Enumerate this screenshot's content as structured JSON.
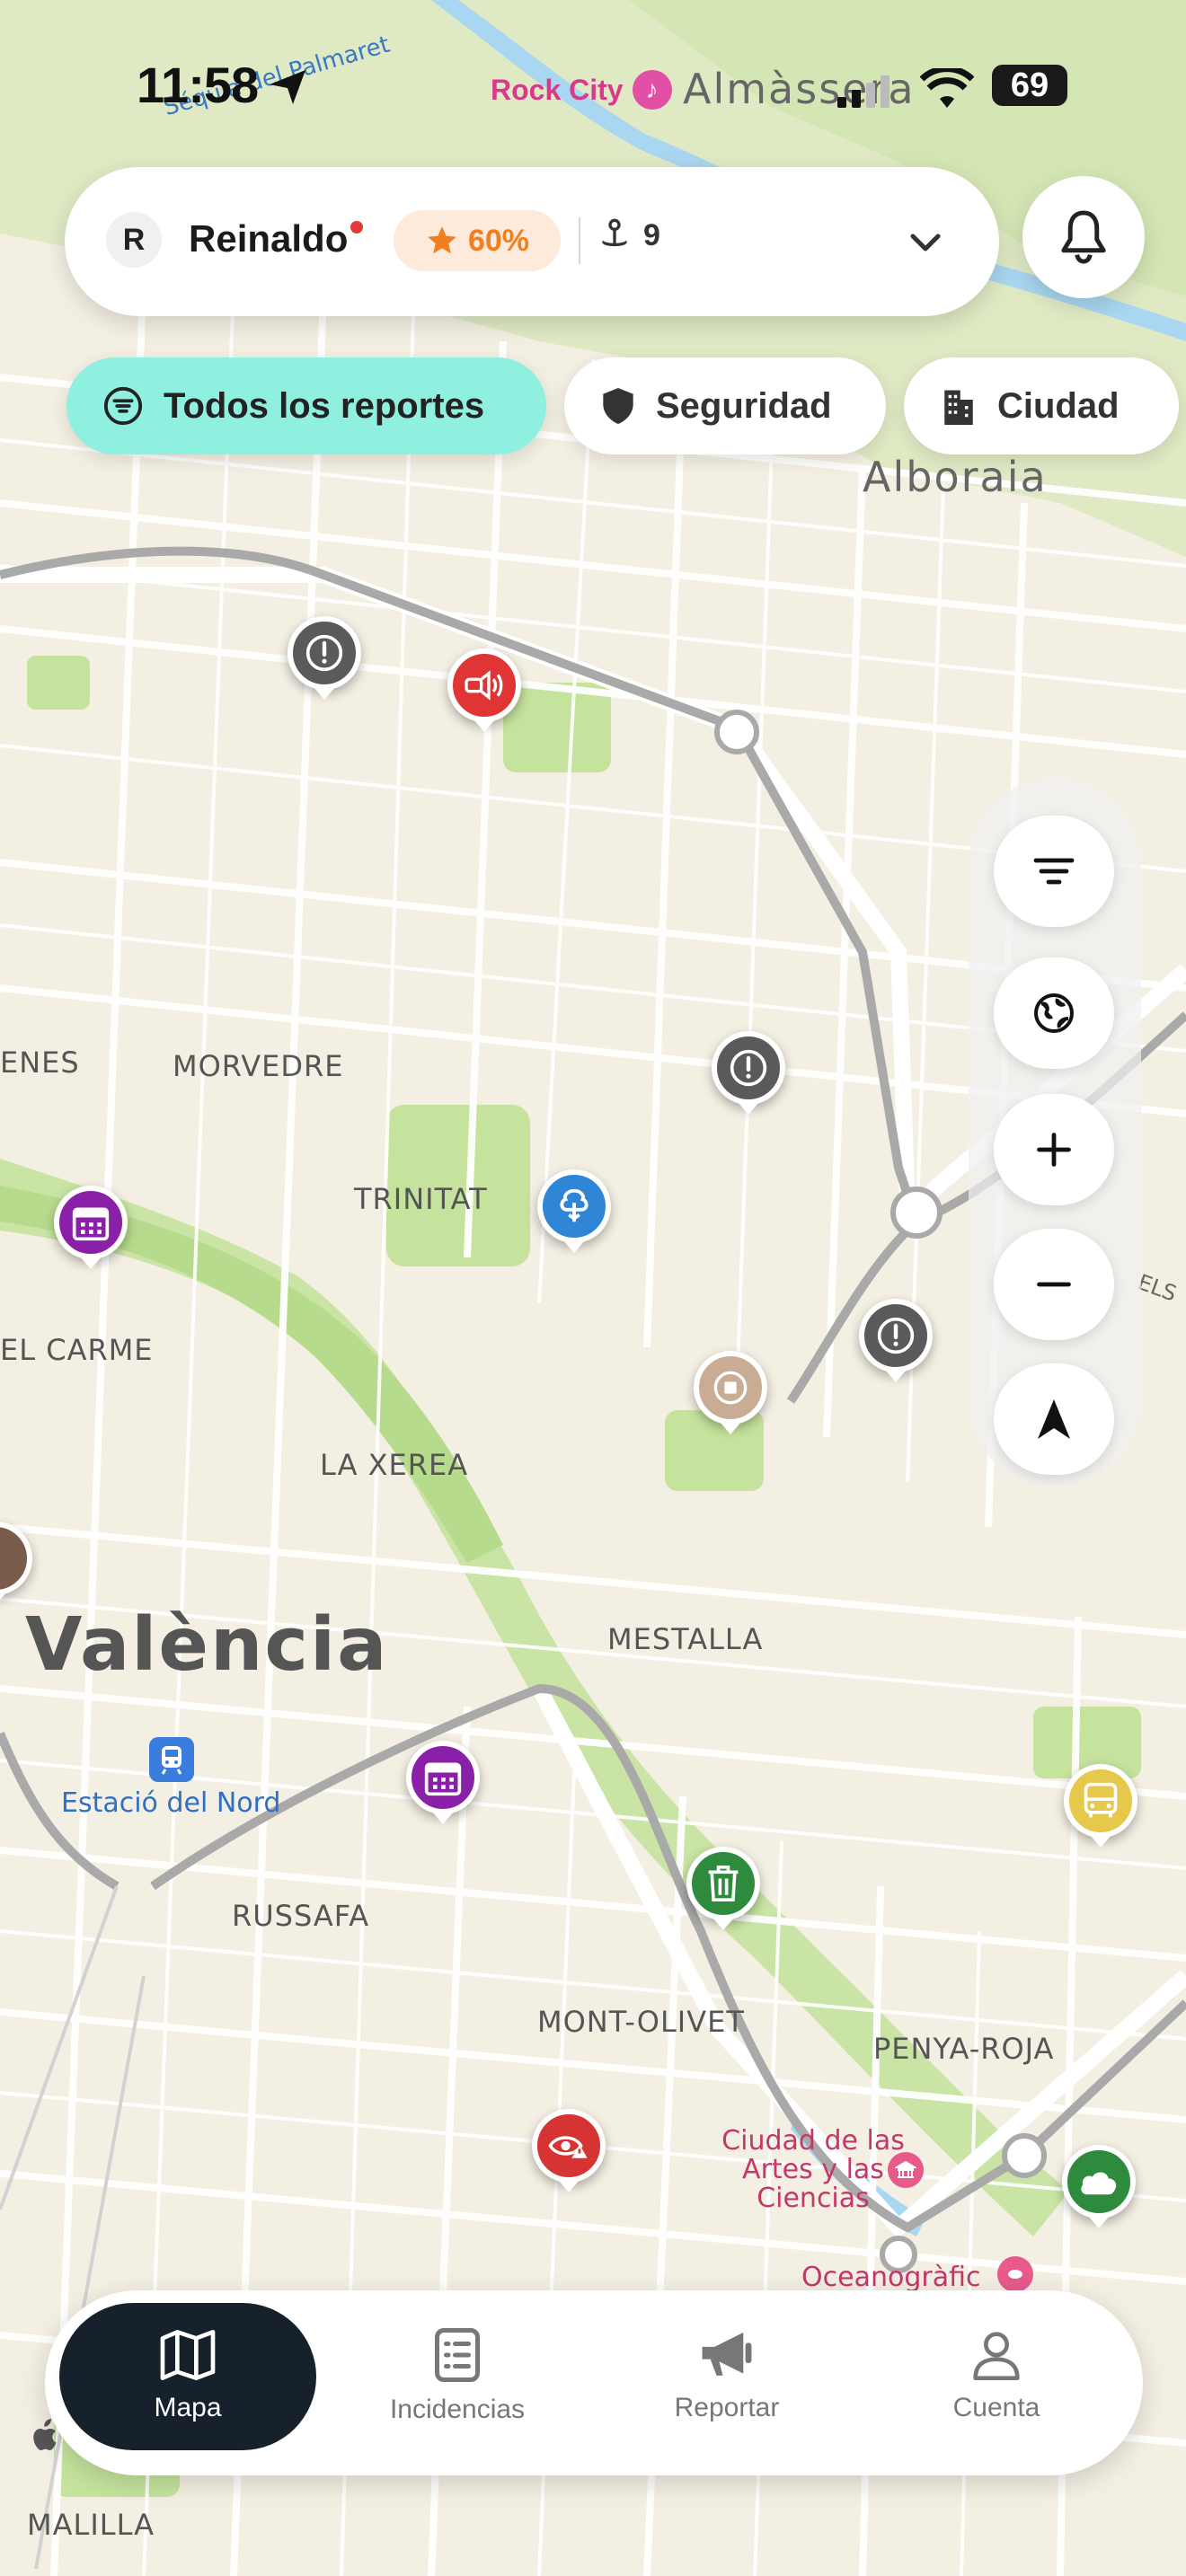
{
  "status_bar": {
    "time": "11:58",
    "battery": "69",
    "now_playing": "Rock City"
  },
  "header": {
    "avatar_initial": "R",
    "username": "Reinaldo",
    "score": "60%",
    "pins_count": "9"
  },
  "filters": [
    {
      "label": "Todos los reportes",
      "icon": "list-filter-icon",
      "active": true
    },
    {
      "label": "Seguridad",
      "icon": "shield-icon",
      "active": false
    },
    {
      "label": "Ciudad",
      "icon": "building-icon",
      "active": false
    }
  ],
  "map_controls": [
    "filter-lines-icon",
    "globe-icon",
    "zoom-in-icon",
    "zoom-out-icon",
    "compass-icon"
  ],
  "map_labels": {
    "street_palmaret": "Séquia del Palmaret",
    "almassera": "Almàssera",
    "alboraia": "Alboraia",
    "morvedre": "MORVEDRE",
    "enes": "ENES",
    "trinitat": "TRINITAT",
    "el_carme": "EL CARME",
    "la_xerea": "LA XEREA",
    "valencia": "València",
    "mestalla": "MESTALLA",
    "estacio": "Estació del Nord",
    "russafa": "RUSSAFA",
    "mont_olivet": "MONT-OLIVET",
    "penya_roja": "PENYA-ROJA",
    "ciudad_artes": "Ciudad de las Artes y las Ciencias",
    "oceanografic": "Oceanogràfic",
    "malilla": "MALILLA",
    "els": "ELS"
  },
  "markers": [
    {
      "type": "alert",
      "color": "#5a5a5a",
      "icon": "alert-circle-icon"
    },
    {
      "type": "noise",
      "color": "#e03535",
      "icon": "speaker-icon"
    },
    {
      "type": "alert",
      "color": "#5a5a5a",
      "icon": "alert-circle-icon"
    },
    {
      "type": "nature",
      "color": "#2f86d6",
      "icon": "tree-icon"
    },
    {
      "type": "event",
      "color": "#8a1fa8",
      "icon": "calendar-icon"
    },
    {
      "type": "alert",
      "color": "#5a5a5a",
      "icon": "alert-circle-icon"
    },
    {
      "type": "other",
      "color": "#c8ad94",
      "icon": "stop-icon"
    },
    {
      "type": "event",
      "color": "#8a1fa8",
      "icon": "calendar-icon"
    },
    {
      "type": "cleaning",
      "color": "#2e8b3e",
      "icon": "trash-icon"
    },
    {
      "type": "transport",
      "color": "#e6c84a",
      "icon": "bus-icon"
    },
    {
      "type": "vandalism",
      "color": "#d63333",
      "icon": "eye-warning-icon"
    },
    {
      "type": "weather",
      "color": "#2e8b3e",
      "icon": "cloud-icon"
    }
  ],
  "nav": [
    {
      "label": "Mapa",
      "icon": "map-icon",
      "active": true
    },
    {
      "label": "Incidencias",
      "icon": "list-icon",
      "active": false
    },
    {
      "label": "Reportar",
      "icon": "megaphone-icon",
      "active": false
    },
    {
      "label": "Cuenta",
      "icon": "user-icon",
      "active": false
    }
  ],
  "colors": {
    "accent": "#8ff0e0",
    "nav_active": "#17212c",
    "score_text": "#f07f22",
    "score_bg": "#fdeadb"
  }
}
